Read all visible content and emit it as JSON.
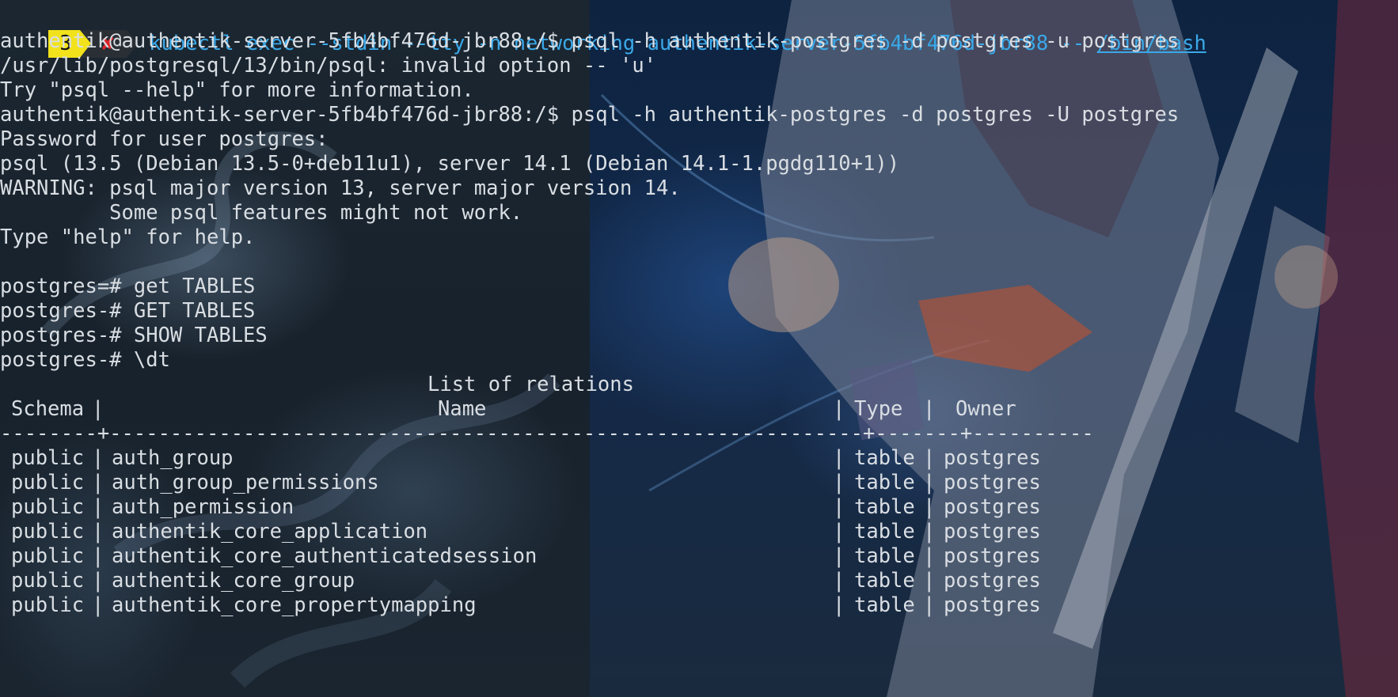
{
  "prompt": {
    "job_number": "3",
    "error_icon": "✘",
    "command_prefix": "kubectl exec --stdin --tty -n networking authentik-server-5fb4bf476d-jbr88 --",
    "command_link": "/bin/bash"
  },
  "session_lines": [
    "authentik@authentik-server-5fb4bf476d-jbr88:/$ psql -h authentik-postgres -d postgres -u postgres",
    "/usr/lib/postgresql/13/bin/psql: invalid option -- 'u'",
    "Try \"psql --help\" for more information.",
    "authentik@authentik-server-5fb4bf476d-jbr88:/$ psql -h authentik-postgres -d postgres -U postgres",
    "Password for user postgres:",
    "psql (13.5 (Debian 13.5-0+deb11u1), server 14.1 (Debian 14.1-1.pgdg110+1))",
    "WARNING: psql major version 13, server major version 14.",
    "         Some psql features might not work.",
    "Type \"help\" for help.",
    "",
    "postgres=# get TABLES",
    "postgres-# GET TABLES",
    "postgres-# SHOW TABLES",
    "postgres-# \\dt"
  ],
  "relations": {
    "title": "List of relations",
    "columns": [
      "Schema",
      "Name",
      "Type",
      "Owner"
    ],
    "separator": "--------+--------------------------------------------------------------+-------+----------",
    "rows": [
      {
        "schema": "public",
        "name": "auth_group",
        "type": "table",
        "owner": "postgres"
      },
      {
        "schema": "public",
        "name": "auth_group_permissions",
        "type": "table",
        "owner": "postgres"
      },
      {
        "schema": "public",
        "name": "auth_permission",
        "type": "table",
        "owner": "postgres"
      },
      {
        "schema": "public",
        "name": "authentik_core_application",
        "type": "table",
        "owner": "postgres"
      },
      {
        "schema": "public",
        "name": "authentik_core_authenticatedsession",
        "type": "table",
        "owner": "postgres"
      },
      {
        "schema": "public",
        "name": "authentik_core_group",
        "type": "table",
        "owner": "postgres"
      },
      {
        "schema": "public",
        "name": "authentik_core_propertymapping",
        "type": "table",
        "owner": "postgres"
      }
    ]
  },
  "colors": {
    "text": "#d9dee3",
    "command": "#3aa8e8",
    "badge_bg": "#f2e21b",
    "error": "#e0262b"
  }
}
